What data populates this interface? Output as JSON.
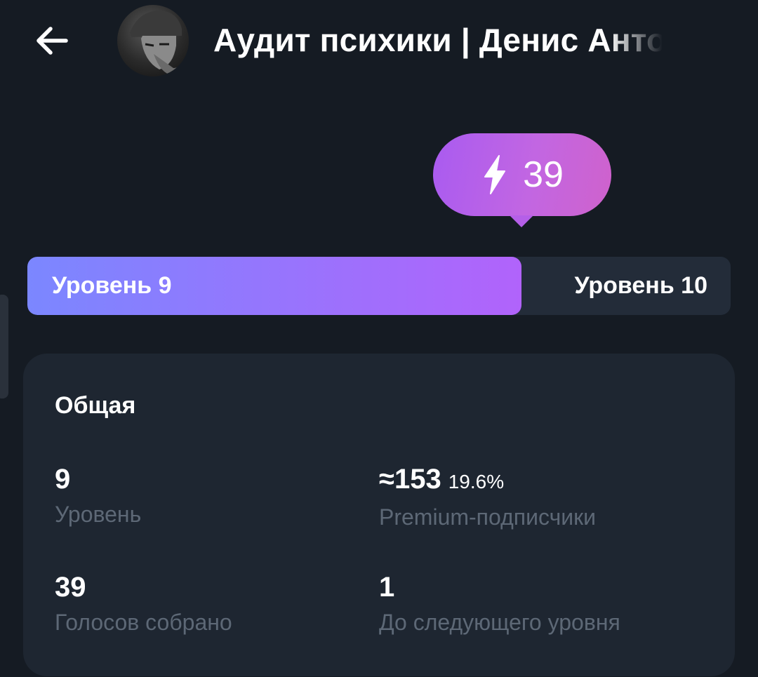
{
  "header": {
    "title": "Аудит психики | Денис Антонов",
    "back_icon": "arrow-left-icon",
    "avatar_icon": "channel-avatar"
  },
  "boost": {
    "icon": "lightning-icon",
    "count": "39"
  },
  "progress": {
    "current_level": "Уровень 9",
    "next_level": "Уровень 10",
    "fill_fraction": 0.703,
    "fill_color_start": "#7b87ff",
    "fill_color_end": "#b163fb"
  },
  "stats": {
    "title": "Общая",
    "level": {
      "value": "9",
      "label": "Уровень"
    },
    "premium": {
      "value": "≈153",
      "sub": "19.6%",
      "label": "Premium-подписчики"
    },
    "votes": {
      "value": "39",
      "label": "Голосов собрано"
    },
    "next": {
      "value": "1",
      "label": "До следующего уровня"
    }
  },
  "colors": {
    "background": "#151b23",
    "card": "#1e2631",
    "muted_text": "#5d6876",
    "accent": "#b55fe8"
  }
}
